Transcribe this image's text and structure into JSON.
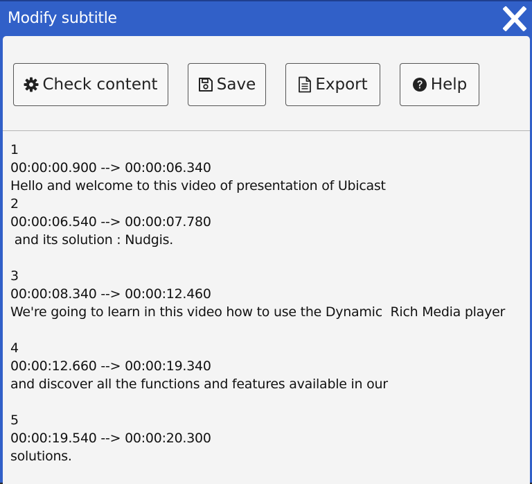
{
  "dialog": {
    "title": "Modify subtitle",
    "close_label": "X"
  },
  "toolbar": {
    "check_content_label": "Check content",
    "save_label": "Save",
    "export_label": "Export",
    "help_label": "Help",
    "icons": {
      "check_content": "gear-icon",
      "save": "floppy-disk-icon",
      "export": "document-icon",
      "help": "question-circle-icon"
    }
  },
  "editor": {
    "content": "1\n00:00:00.900 --> 00:00:06.340\nHello and welcome to this video of presentation of Ubicast\n2\n00:00:06.540 --> 00:00:07.780\n and its solution : Nudgis.\n\n3\n00:00:08.340 --> 00:00:12.460\nWe're going to learn in this video how to use the Dynamic  Rich Media player\n\n4\n00:00:12.660 --> 00:00:19.340\nand discover all the functions and features available in our\n\n5\n00:00:19.540 --> 00:00:20.300\nsolutions."
  },
  "colors": {
    "title_bar": "#3160c8",
    "panel_background": "#f4f4f4",
    "button_border": "#555555",
    "text": "#111111"
  }
}
